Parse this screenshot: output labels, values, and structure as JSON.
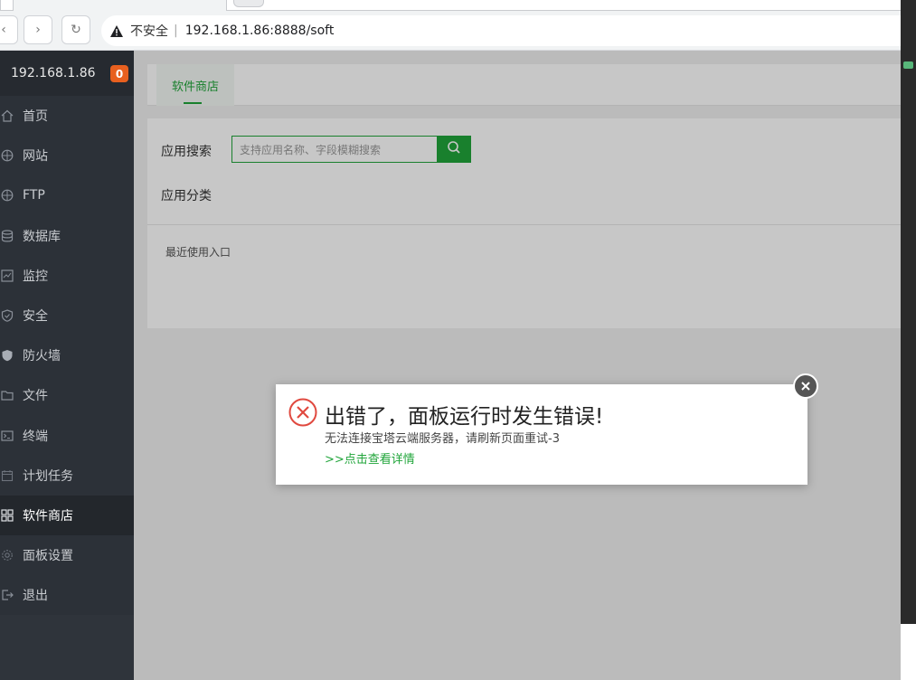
{
  "browser": {
    "back_glyph": "‹",
    "forward_glyph": "›",
    "reload_glyph": "↻",
    "insecure_label": "不安全",
    "separator": "|",
    "url": "192.168.1.86:8888/soft"
  },
  "sidebar": {
    "host": "192.168.1.86",
    "badge_count": "0",
    "items": [
      {
        "label": "首页",
        "icon": "home-icon"
      },
      {
        "label": "网站",
        "icon": "globe-icon"
      },
      {
        "label": "FTP",
        "icon": "globe-icon"
      },
      {
        "label": "数据库",
        "icon": "database-icon"
      },
      {
        "label": "监控",
        "icon": "monitor-icon"
      },
      {
        "label": "安全",
        "icon": "shield-icon"
      },
      {
        "label": "防火墙",
        "icon": "firewall-icon"
      },
      {
        "label": "文件",
        "icon": "folder-icon"
      },
      {
        "label": "终端",
        "icon": "terminal-icon"
      },
      {
        "label": "计划任务",
        "icon": "calendar-icon"
      },
      {
        "label": "软件商店",
        "icon": "grid-icon",
        "active": true
      },
      {
        "label": "面板设置",
        "icon": "gear-icon"
      },
      {
        "label": "退出",
        "icon": "logout-icon"
      }
    ]
  },
  "main": {
    "tab_label": "软件商店",
    "search_label": "应用搜索",
    "search_placeholder": "支持应用名称、字段模糊搜索",
    "category_label": "应用分类",
    "recent_label": "最近使用入口"
  },
  "dialog": {
    "title": "出错了，面板运行时发生错误!",
    "message": "无法连接宝塔云端服务器，请刷新页面重试-3",
    "details_link": ">>点击查看详情"
  },
  "colors": {
    "accent": "#20a53a",
    "sidebar_bg": "#2c3138",
    "badge": "#e8601f",
    "error": "#e0493f"
  }
}
